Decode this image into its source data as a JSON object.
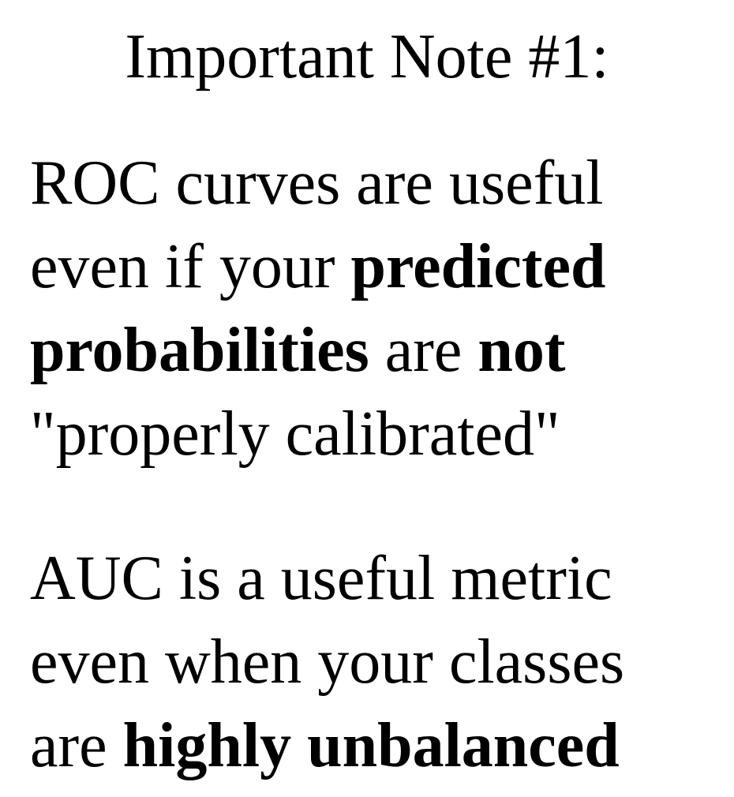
{
  "title": "Important Note #1:",
  "note1": {
    "line1": "ROC curves are useful",
    "line2_a": "even if your ",
    "line2_b": "predicted",
    "line3_a": "probabilities",
    "line3_b": " are ",
    "line3_c": "not",
    "line4": "\"properly calibrated\""
  },
  "note2": {
    "line1": "AUC is a useful metric",
    "line2": "even when your classes",
    "line3_a": "are ",
    "line3_b": "highly unbalanced"
  }
}
